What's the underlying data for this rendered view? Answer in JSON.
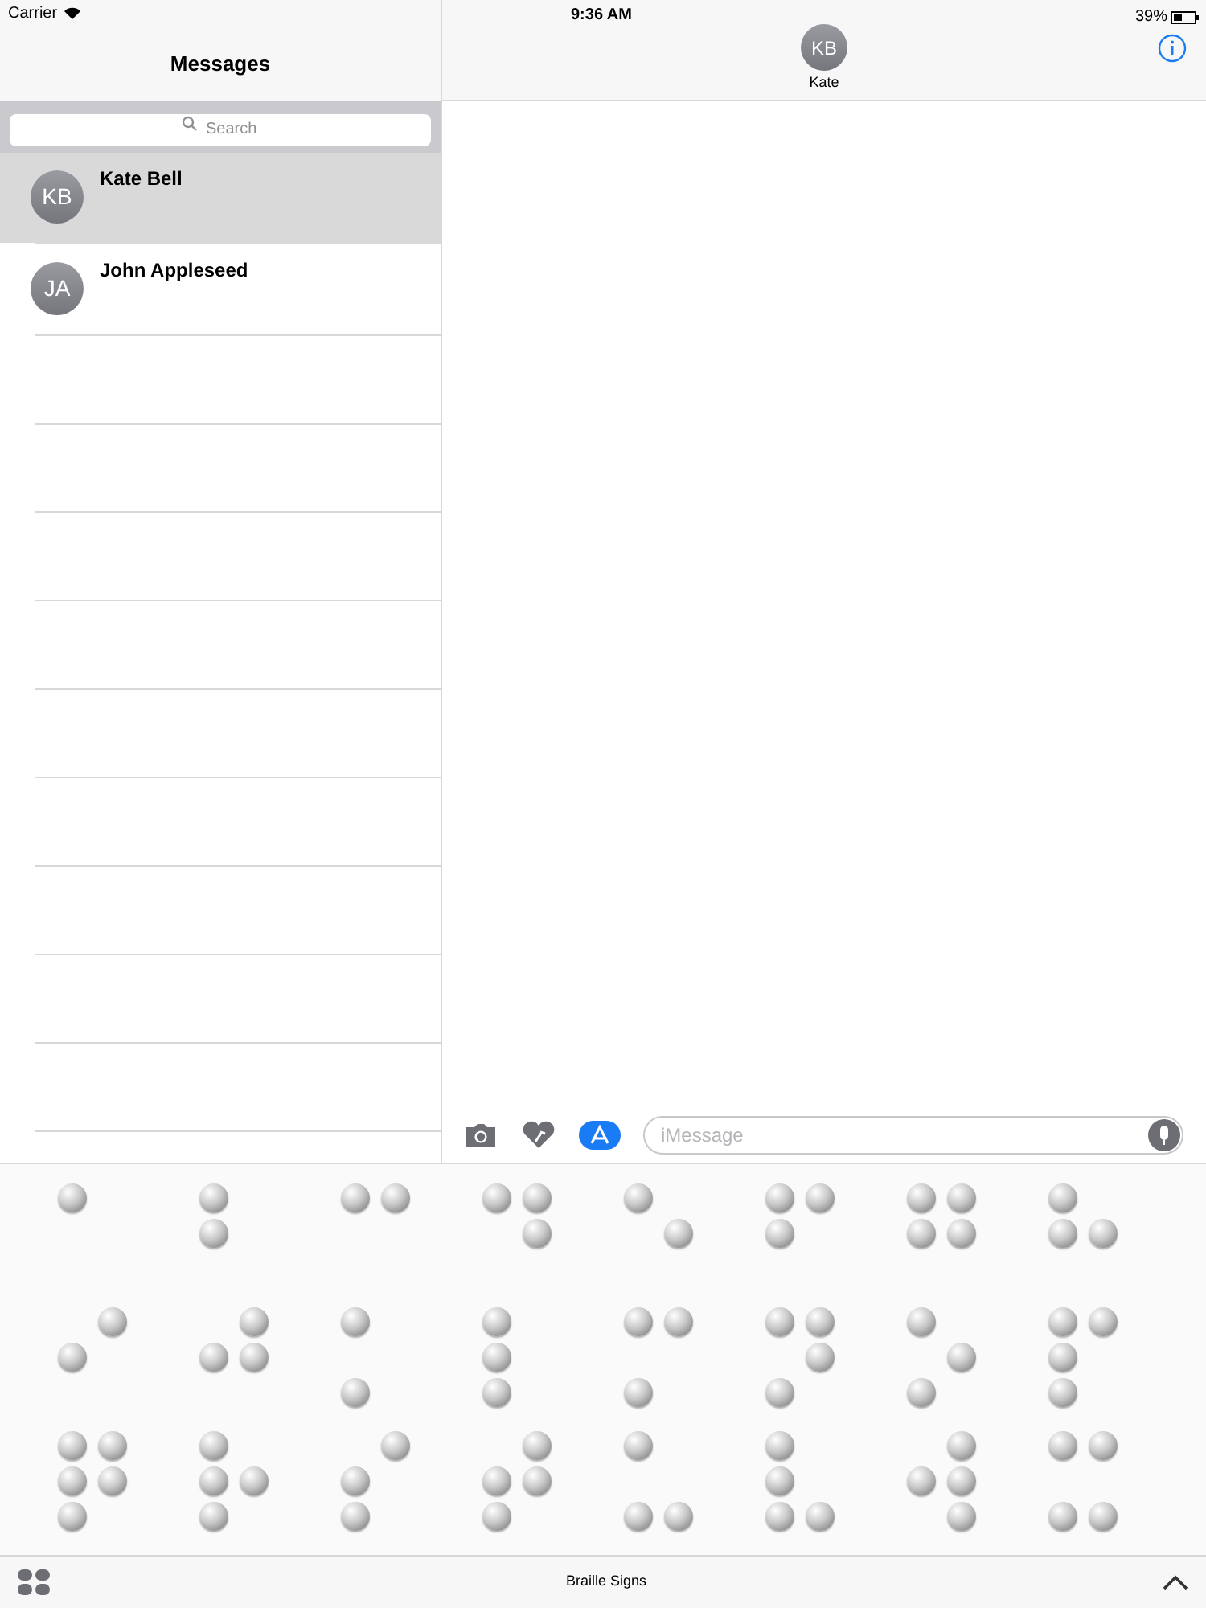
{
  "status_bar": {
    "carrier": "Carrier",
    "time": "9:36 AM",
    "battery": "39%"
  },
  "sidebar": {
    "title": "Messages",
    "search": {
      "placeholder": "Search"
    },
    "conversations": [
      {
        "initials": "KB",
        "name": "Kate Bell",
        "selected": true
      },
      {
        "initials": "JA",
        "name": "John Appleseed",
        "selected": false
      }
    ]
  },
  "conversation": {
    "initials": "KB",
    "name": "Kate"
  },
  "compose": {
    "placeholder": "iMessage"
  },
  "stickers": [
    {
      "dots": [
        true,
        false,
        false,
        false,
        false,
        false
      ]
    },
    {
      "dots": [
        true,
        true,
        false,
        false,
        false,
        false
      ]
    },
    {
      "dots": [
        true,
        false,
        false,
        true,
        false,
        false
      ]
    },
    {
      "dots": [
        true,
        false,
        false,
        true,
        true,
        false
      ]
    },
    {
      "dots": [
        true,
        false,
        false,
        false,
        true,
        false
      ]
    },
    {
      "dots": [
        true,
        true,
        false,
        true,
        false,
        false
      ]
    },
    {
      "dots": [
        true,
        true,
        false,
        true,
        true,
        false
      ]
    },
    {
      "dots": [
        true,
        true,
        false,
        false,
        true,
        false
      ]
    },
    {
      "dots": [
        false,
        true,
        false,
        true,
        false,
        false
      ]
    },
    {
      "dots": [
        false,
        true,
        false,
        true,
        true,
        false
      ]
    },
    {
      "dots": [
        true,
        false,
        true,
        false,
        false,
        false
      ]
    },
    {
      "dots": [
        true,
        true,
        true,
        false,
        false,
        false
      ]
    },
    {
      "dots": [
        true,
        false,
        true,
        true,
        false,
        false
      ]
    },
    {
      "dots": [
        true,
        false,
        true,
        true,
        true,
        false
      ]
    },
    {
      "dots": [
        true,
        false,
        true,
        false,
        true,
        false
      ]
    },
    {
      "dots": [
        true,
        true,
        true,
        true,
        false,
        false
      ]
    },
    {
      "dots": [
        true,
        true,
        true,
        true,
        true,
        false
      ]
    },
    {
      "dots": [
        true,
        true,
        true,
        false,
        true,
        false
      ]
    },
    {
      "dots": [
        false,
        true,
        true,
        true,
        false,
        false
      ]
    },
    {
      "dots": [
        false,
        true,
        true,
        true,
        true,
        false
      ]
    },
    {
      "dots": [
        true,
        false,
        true,
        false,
        false,
        true
      ]
    },
    {
      "dots": [
        true,
        true,
        true,
        false,
        false,
        true
      ]
    },
    {
      "dots": [
        false,
        true,
        false,
        true,
        true,
        true
      ]
    },
    {
      "dots": [
        true,
        false,
        true,
        true,
        false,
        true
      ]
    }
  ],
  "drawer": {
    "title": "Braille Signs"
  }
}
